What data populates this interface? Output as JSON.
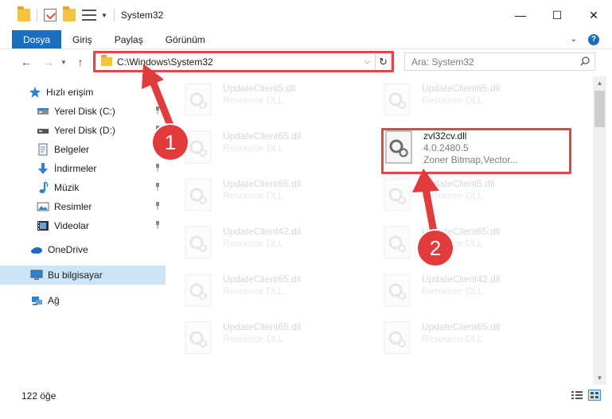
{
  "window": {
    "title": "System32",
    "controls": {
      "minimize": "—",
      "maximize": "☐",
      "close": "✕"
    }
  },
  "ribbon": {
    "tabs": [
      "Dosya",
      "Giriş",
      "Paylaş",
      "Görünüm"
    ]
  },
  "navigation": {
    "address": "C:\\Windows\\System32",
    "search_placeholder": "Ara: System32"
  },
  "sidebar": {
    "quick_access": "Hızlı erişim",
    "items": [
      {
        "label": "Yerel Disk (C:)",
        "icon": "drive-icon",
        "pinned": true
      },
      {
        "label": "Yerel Disk (D:)",
        "icon": "drive-icon",
        "pinned": true
      },
      {
        "label": "Belgeler",
        "icon": "documents-icon",
        "pinned": true
      },
      {
        "label": "İndirmeler",
        "icon": "download-icon",
        "pinned": true
      },
      {
        "label": "Müzik",
        "icon": "music-icon",
        "pinned": true
      },
      {
        "label": "Resimler",
        "icon": "pictures-icon",
        "pinned": true
      },
      {
        "label": "Videolar",
        "icon": "video-icon",
        "pinned": true
      }
    ],
    "onedrive": "OneDrive",
    "this_pc": "Bu bilgisayar",
    "network": "Ağ"
  },
  "files": {
    "left_column": [
      {
        "name": "UpdateClient5.dll",
        "type": "Resource DLL"
      },
      {
        "name": "UpdateClient65.dll",
        "type": "Resource DLL"
      },
      {
        "name": "UpdateClient65.dll",
        "type": "Resource DLL"
      },
      {
        "name": "UpdateClient42.dll",
        "type": "Resource DLL"
      },
      {
        "name": "UpdateClient65.dll",
        "type": "Resource DLL"
      },
      {
        "name": "UpdateClient65.dll",
        "type": "Resource DLL"
      }
    ],
    "right_column": [
      {
        "name": "UpdateClient65.dll",
        "type": "Resource DLL"
      },
      {
        "name": "UpdateClient5.dll",
        "type": "Resource DLL"
      },
      {
        "name": "UpdateClient65.dll",
        "type": "Resource DLL"
      },
      {
        "name": "UpdateClient42.dll",
        "type": "Resource DLL"
      },
      {
        "name": "UpdateClient65.dll",
        "type": "Resource DLL"
      }
    ],
    "highlighted": {
      "name": "zvl32cv.dll",
      "version": "4.0.2480.5",
      "description": "Zoner Bitmap,Vector..."
    }
  },
  "status": {
    "item_count": "122 öğe"
  },
  "annotations": {
    "step1": "1",
    "step2": "2",
    "color": "#e23b3b"
  }
}
